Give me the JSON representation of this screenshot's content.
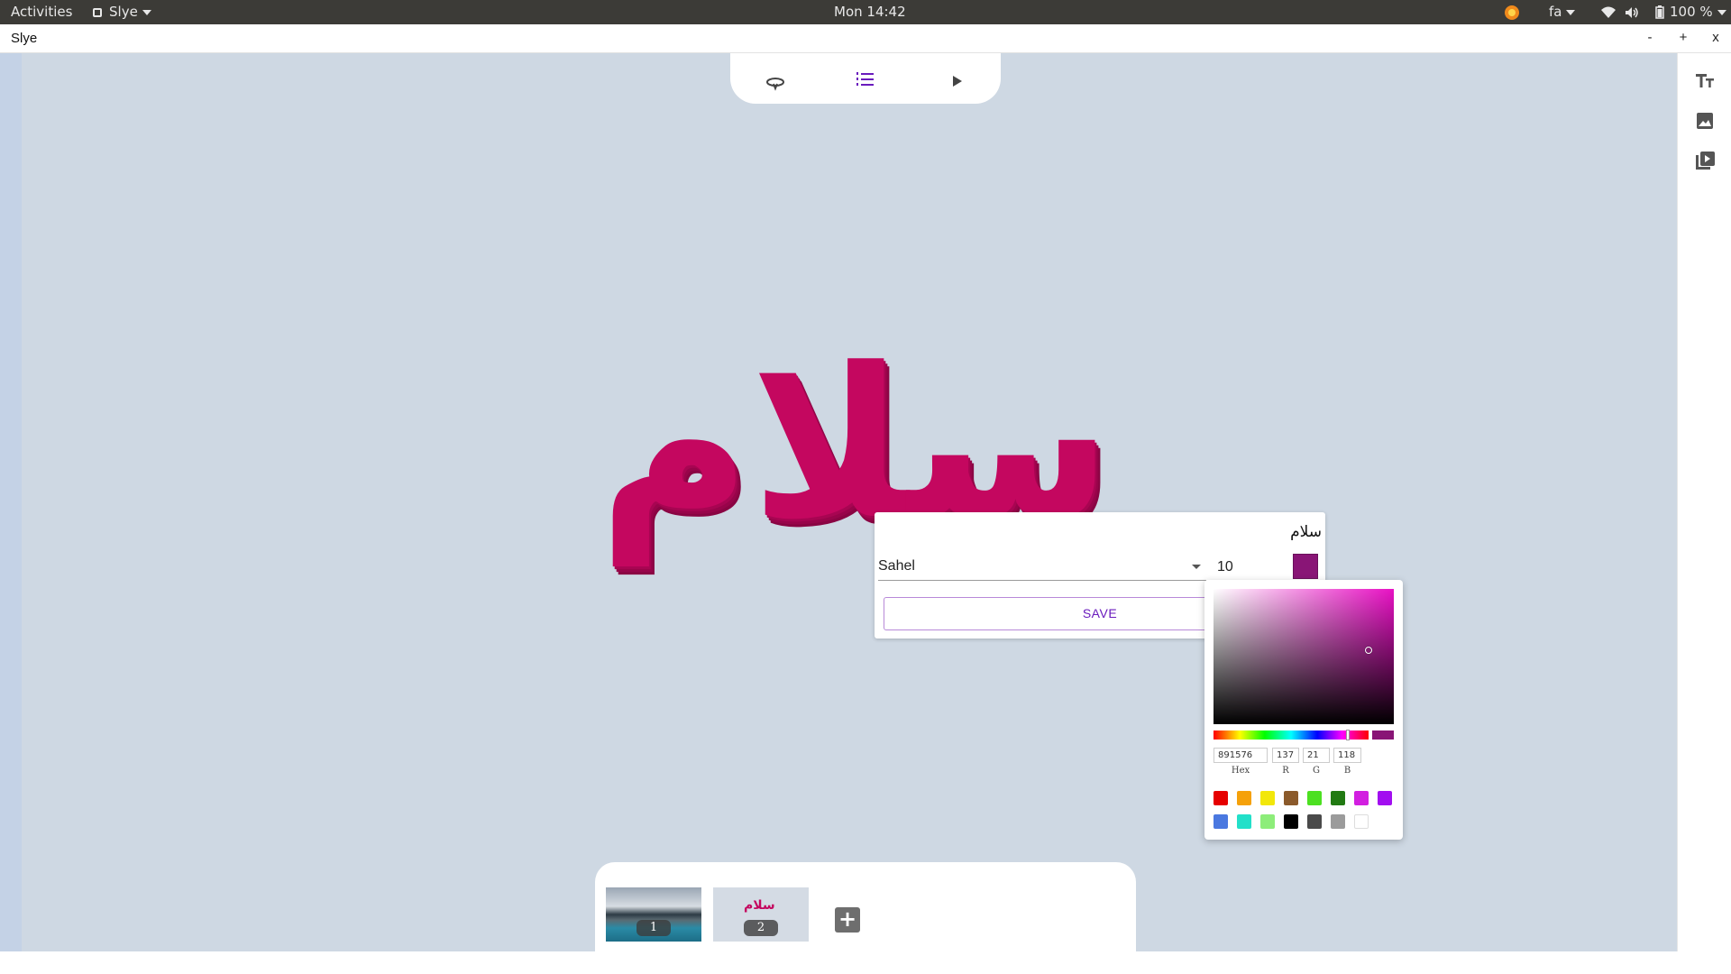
{
  "topbar": {
    "activities": "Activities",
    "app_menu": "Slye",
    "clock": "Mon 14:42",
    "keyboard_layout": "fa",
    "battery": "100 %"
  },
  "window": {
    "title": "Slye",
    "minimize": "-",
    "maximize": "+",
    "close": "x"
  },
  "toolbar": {
    "icons": [
      "rotate-icon",
      "list-icon",
      "play-icon"
    ]
  },
  "right_panel": {
    "icons": [
      "text-icon",
      "image-icon",
      "video-icon"
    ]
  },
  "canvas": {
    "text": "سلام",
    "text_color": "#c4075f"
  },
  "editor": {
    "text_value": "سلام",
    "font": "Sahel",
    "size": "10",
    "color": "#891576",
    "save_label": "SAVE"
  },
  "color_picker": {
    "hex": "891576",
    "r": "137",
    "g": "21",
    "b": "118",
    "hex_label": "Hex",
    "r_label": "R",
    "g_label": "G",
    "b_label": "B",
    "presets_row1": [
      "#e60000",
      "#f5a10a",
      "#f2e70a",
      "#8b5a2b",
      "#4ce021",
      "#217a12",
      "#d21fe0",
      "#a20ef0"
    ],
    "presets_row2": [
      "#4a78e0",
      "#22e0c9",
      "#8ded7a",
      "#000000",
      "#4a4a4a",
      "#9b9b9b",
      "#ffffff"
    ]
  },
  "slides": {
    "items": [
      {
        "number": "1"
      },
      {
        "number": "2",
        "preview_text": "سلام"
      }
    ]
  }
}
